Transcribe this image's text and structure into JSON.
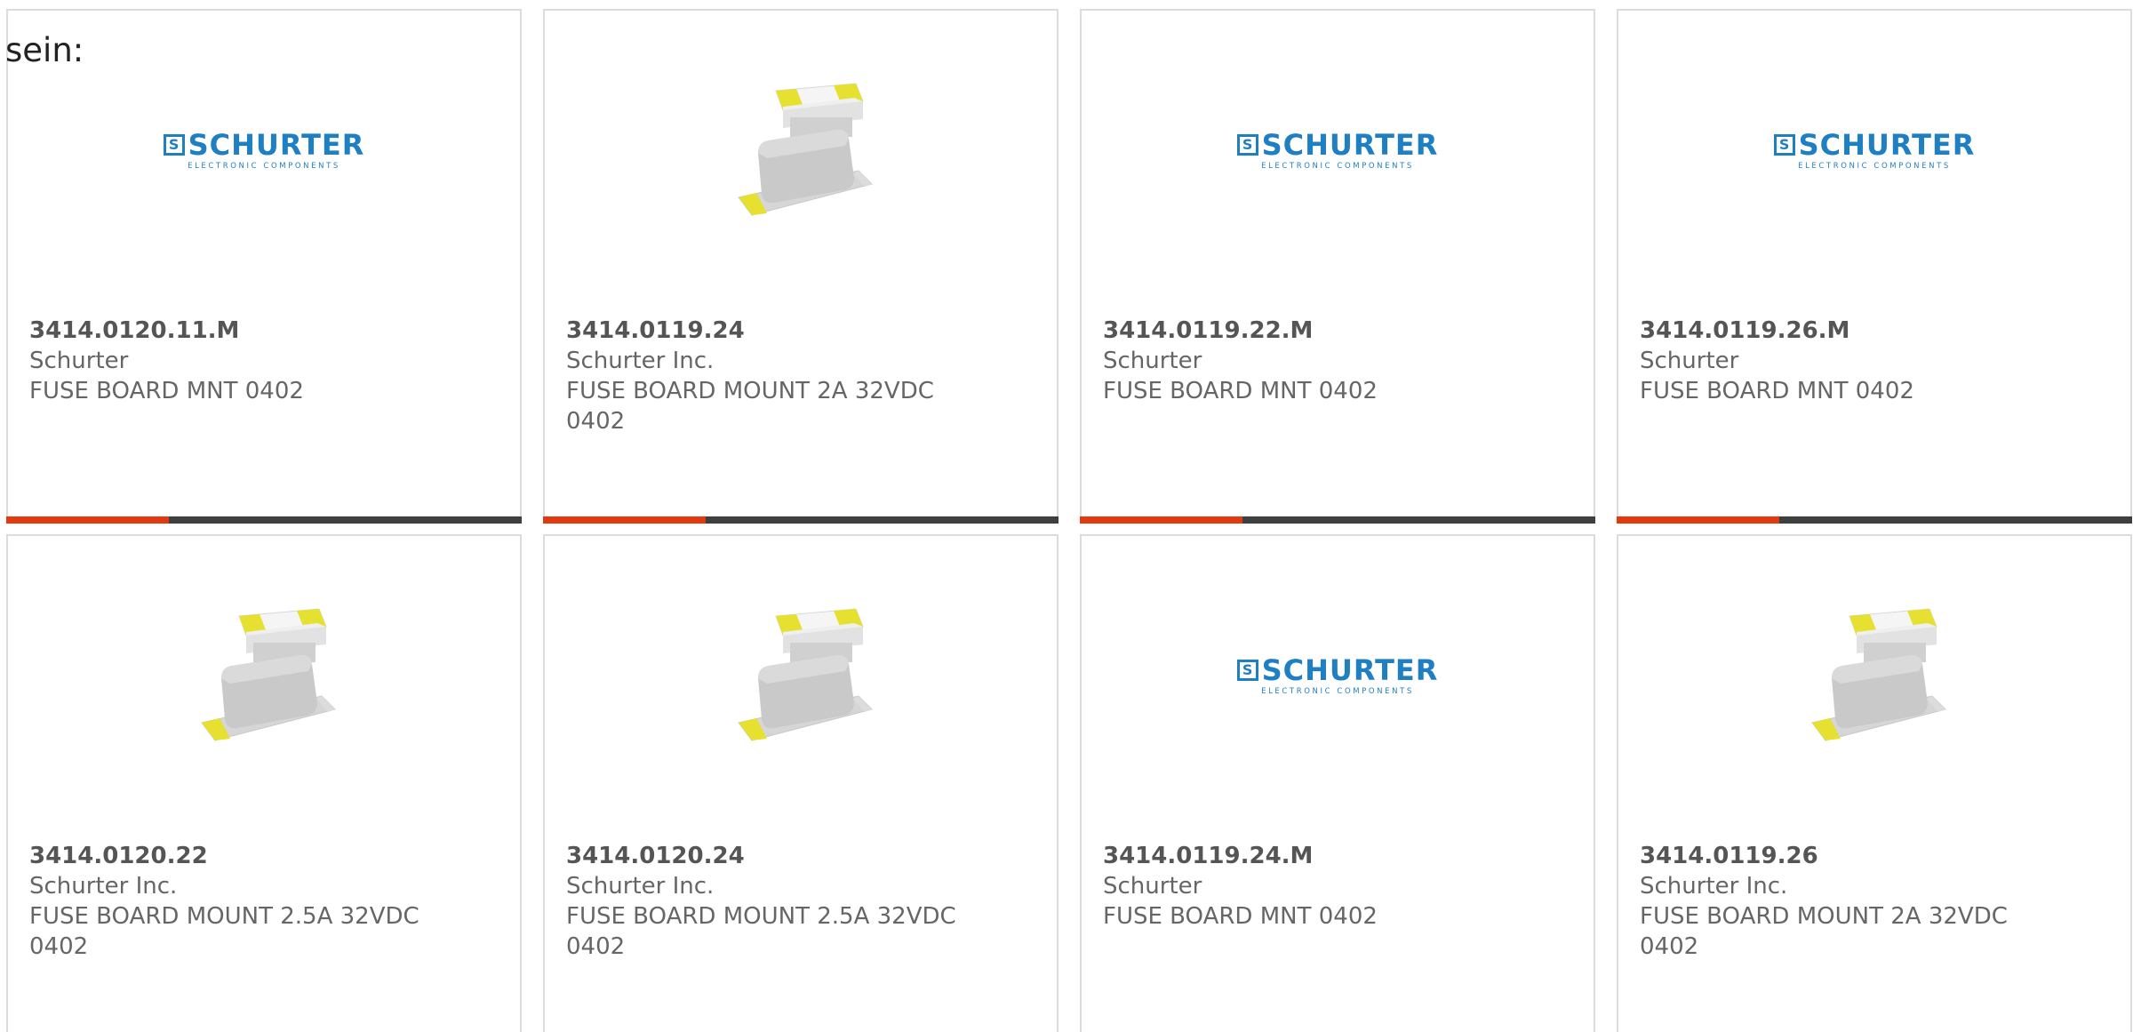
{
  "intro_text": "sein:",
  "logo": {
    "mark": "S",
    "name": "SCHURTER",
    "tagline": "ELECTRONIC COMPONENTS"
  },
  "colors": {
    "accent": "#e23a10",
    "bar": "#3f3f3f",
    "logo_blue": "#1f7fc3",
    "fuse_yellow": "#e6e031"
  },
  "products": [
    {
      "part_number": "3414.0120.11.M",
      "manufacturer": "Schurter",
      "description": "FUSE BOARD MNT 0402",
      "image": "schurter-logo"
    },
    {
      "part_number": "3414.0119.24",
      "manufacturer": "Schurter Inc.",
      "description": "FUSE BOARD MOUNT 2A 32VDC 0402",
      "image": "fuse-photo"
    },
    {
      "part_number": "3414.0119.22.M",
      "manufacturer": "Schurter",
      "description": "FUSE BOARD MNT 0402",
      "image": "schurter-logo"
    },
    {
      "part_number": "3414.0119.26.M",
      "manufacturer": "Schurter",
      "description": "FUSE BOARD MNT 0402",
      "image": "schurter-logo"
    },
    {
      "part_number": "3414.0120.22",
      "manufacturer": "Schurter Inc.",
      "description": "FUSE BOARD MOUNT 2.5A 32VDC 0402",
      "image": "fuse-photo"
    },
    {
      "part_number": "3414.0120.24",
      "manufacturer": "Schurter Inc.",
      "description": "FUSE BOARD MOUNT 2.5A 32VDC 0402",
      "image": "fuse-photo"
    },
    {
      "part_number": "3414.0119.24.M",
      "manufacturer": "Schurter",
      "description": "FUSE BOARD MNT 0402",
      "image": "schurter-logo"
    },
    {
      "part_number": "3414.0119.26",
      "manufacturer": "Schurter Inc.",
      "description": "FUSE BOARD MOUNT 2A 32VDC 0402",
      "image": "fuse-photo"
    }
  ]
}
